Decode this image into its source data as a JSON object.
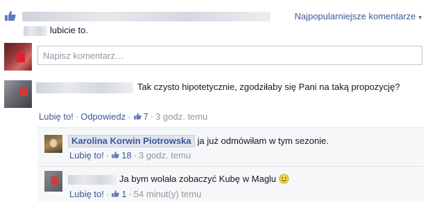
{
  "header": {
    "likes_suffix": "lubicie to.",
    "sort_label": "Najpopularniejsze komentarze",
    "sort_caret": "▾"
  },
  "composer": {
    "placeholder": "Napisz komentarz…"
  },
  "comments": [
    {
      "text": "Tak czysto hipotetycznie, zgodziłaby się Pani na taką propozycję?",
      "like_label": "Lubię to!",
      "reply_label": "Odpowiedz",
      "like_count": "7",
      "time": "3 godz. temu"
    }
  ],
  "replies": [
    {
      "author": "Karolina Korwin Piotrowska",
      "text": "ja już odmówiłam w tym sezonie.",
      "like_label": "Lubię to!",
      "like_count": "18",
      "time": "3 godz. temu"
    },
    {
      "text": "Ja bym wolała zobaczyć Kubę w Maglu",
      "like_label": "Lubię to!",
      "like_count": "1",
      "time": "54 minut(y) temu"
    }
  ],
  "separator": "·",
  "colors": {
    "link": "#3b5998",
    "muted": "#9197a3",
    "reply_bg": "#f6f7f8"
  },
  "icons": {
    "like": "thumbs-up-icon",
    "sort": "caret-down-icon",
    "emoji": "smiley-icon"
  }
}
